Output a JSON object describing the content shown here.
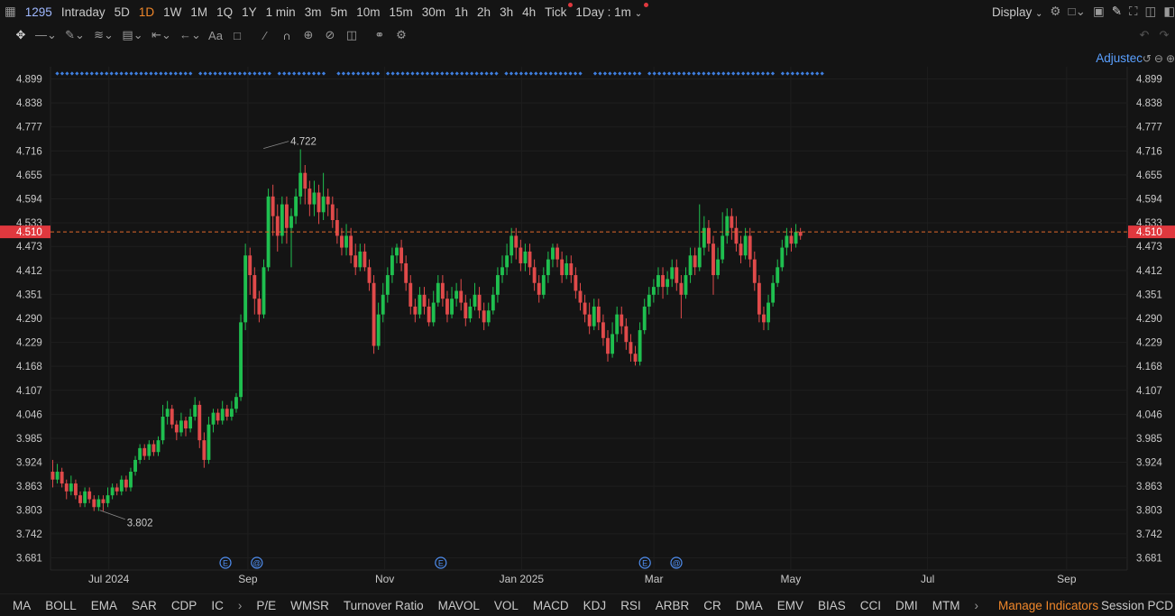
{
  "topbar": {
    "symbol": "1295",
    "timeframes": [
      "Intraday",
      "5D",
      "1D",
      "1W",
      "1M",
      "1Q",
      "1Y",
      "1 min",
      "3m",
      "5m",
      "10m",
      "15m",
      "30m",
      "1h",
      "2h",
      "3h",
      "4h",
      "Tick"
    ],
    "active_timeframe": "1D",
    "interval": "1Day : 1m",
    "display_label": "Display"
  },
  "adjust_label": "Adjustec",
  "chart_data": {
    "type": "candlestick",
    "y_ticks": [
      "4.899",
      "4.838",
      "4.777",
      "4.716",
      "4.655",
      "4.594",
      "4.533",
      "4.473",
      "4.412",
      "4.351",
      "4.290",
      "4.229",
      "4.168",
      "4.107",
      "4.046",
      "3.985",
      "3.924",
      "3.863",
      "3.803",
      "3.742",
      "3.681"
    ],
    "ylim": [
      3.65,
      4.93
    ],
    "x_ticks": [
      {
        "label": "Jul 2024",
        "day": 26
      },
      {
        "label": "Sep",
        "day": 88
      },
      {
        "label": "Nov",
        "day": 149
      },
      {
        "label": "Jan 2025",
        "day": 210
      },
      {
        "label": "Mar",
        "day": 269
      },
      {
        "label": "May",
        "day": 330
      },
      {
        "label": "Jul",
        "day": 391
      },
      {
        "label": "Sep",
        "day": 453
      }
    ],
    "xlim": [
      0,
      480
    ],
    "current_price": "4.510",
    "current_value": 4.51,
    "high_annotation": {
      "label": "4.722",
      "value": 4.722,
      "day": 94
    },
    "low_annotation": {
      "label": "3.802",
      "value": 3.802,
      "day": 11
    },
    "event_markers": [
      {
        "symbol": "E",
        "day": 78
      },
      {
        "symbol": "@",
        "day": 92
      },
      {
        "symbol": "E",
        "day": 174
      },
      {
        "symbol": "E",
        "day": 265
      },
      {
        "symbol": "@",
        "day": 279
      }
    ],
    "candles": [
      [
        3.9,
        3.88,
        3.93,
        3.86
      ],
      [
        3.88,
        3.9,
        3.92,
        3.87
      ],
      [
        3.9,
        3.87,
        3.91,
        3.86
      ],
      [
        3.87,
        3.85,
        3.88,
        3.83
      ],
      [
        3.85,
        3.87,
        3.89,
        3.84
      ],
      [
        3.87,
        3.84,
        3.88,
        3.83
      ],
      [
        3.84,
        3.82,
        3.85,
        3.81
      ],
      [
        3.82,
        3.85,
        3.86,
        3.81
      ],
      [
        3.85,
        3.83,
        3.86,
        3.82
      ],
      [
        3.83,
        3.81,
        3.84,
        3.8
      ],
      [
        3.81,
        3.83,
        3.84,
        3.8
      ],
      [
        3.83,
        3.82,
        3.84,
        3.8
      ],
      [
        3.82,
        3.84,
        3.86,
        3.81
      ],
      [
        3.84,
        3.86,
        3.87,
        3.83
      ],
      [
        3.86,
        3.85,
        3.87,
        3.84
      ],
      [
        3.85,
        3.88,
        3.89,
        3.84
      ],
      [
        3.88,
        3.86,
        3.89,
        3.85
      ],
      [
        3.86,
        3.9,
        3.91,
        3.85
      ],
      [
        3.9,
        3.93,
        3.94,
        3.89
      ],
      [
        3.93,
        3.96,
        3.97,
        3.92
      ],
      [
        3.96,
        3.94,
        3.97,
        3.93
      ],
      [
        3.94,
        3.97,
        3.98,
        3.93
      ],
      [
        3.97,
        3.95,
        3.98,
        3.94
      ],
      [
        3.95,
        3.98,
        3.99,
        3.94
      ],
      [
        3.98,
        4.04,
        4.07,
        3.97
      ],
      [
        4.04,
        4.06,
        4.08,
        4.02
      ],
      [
        4.06,
        4.02,
        4.07,
        4.01
      ],
      [
        4.02,
        4.0,
        4.03,
        3.98
      ],
      [
        4.0,
        4.03,
        4.05,
        3.99
      ],
      [
        4.03,
        4.01,
        4.04,
        3.99
      ],
      [
        4.01,
        4.04,
        4.06,
        4.0
      ],
      [
        4.04,
        4.07,
        4.09,
        4.03
      ],
      [
        4.07,
        3.98,
        4.08,
        3.96
      ],
      [
        3.98,
        3.93,
        4.0,
        3.91
      ],
      [
        3.93,
        4.02,
        4.04,
        3.92
      ],
      [
        4.02,
        4.05,
        4.06,
        4.0
      ],
      [
        4.05,
        4.03,
        4.06,
        4.02
      ],
      [
        4.03,
        4.06,
        4.08,
        4.02
      ],
      [
        4.06,
        4.04,
        4.07,
        4.03
      ],
      [
        4.04,
        4.06,
        4.08,
        4.03
      ],
      [
        4.06,
        4.09,
        4.1,
        4.05
      ],
      [
        4.09,
        4.28,
        4.3,
        4.08
      ],
      [
        4.28,
        4.45,
        4.48,
        4.26
      ],
      [
        4.45,
        4.4,
        4.47,
        4.35
      ],
      [
        4.4,
        4.34,
        4.42,
        4.3
      ],
      [
        4.34,
        4.3,
        4.36,
        4.28
      ],
      [
        4.3,
        4.42,
        4.44,
        4.29
      ],
      [
        4.42,
        4.6,
        4.62,
        4.41
      ],
      [
        4.6,
        4.55,
        4.63,
        4.5
      ],
      [
        4.55,
        4.5,
        4.58,
        4.46
      ],
      [
        4.5,
        4.58,
        4.6,
        4.48
      ],
      [
        4.58,
        4.52,
        4.6,
        4.48
      ],
      [
        4.52,
        4.55,
        4.57,
        4.42
      ],
      [
        4.55,
        4.6,
        4.62,
        4.53
      ],
      [
        4.6,
        4.66,
        4.72,
        4.58
      ],
      [
        4.66,
        4.62,
        4.68,
        4.58
      ],
      [
        4.62,
        4.58,
        4.64,
        4.55
      ],
      [
        4.58,
        4.61,
        4.64,
        4.55
      ],
      [
        4.61,
        4.56,
        4.63,
        4.53
      ],
      [
        4.56,
        4.6,
        4.66,
        4.54
      ],
      [
        4.6,
        4.58,
        4.62,
        4.55
      ],
      [
        4.58,
        4.54,
        4.6,
        4.52
      ],
      [
        4.54,
        4.5,
        4.57,
        4.48
      ],
      [
        4.5,
        4.47,
        4.52,
        4.45
      ],
      [
        4.47,
        4.5,
        4.53,
        4.45
      ],
      [
        4.5,
        4.45,
        4.52,
        4.43
      ],
      [
        4.45,
        4.42,
        4.48,
        4.4
      ],
      [
        4.42,
        4.46,
        4.48,
        4.41
      ],
      [
        4.46,
        4.42,
        4.48,
        4.41
      ],
      [
        4.42,
        4.38,
        4.44,
        4.36
      ],
      [
        4.38,
        4.22,
        4.4,
        4.2
      ],
      [
        4.22,
        4.3,
        4.33,
        4.21
      ],
      [
        4.3,
        4.35,
        4.38,
        4.28
      ],
      [
        4.35,
        4.4,
        4.42,
        4.33
      ],
      [
        4.4,
        4.45,
        4.47,
        4.38
      ],
      [
        4.45,
        4.47,
        4.48,
        4.43
      ],
      [
        4.47,
        4.43,
        4.49,
        4.41
      ],
      [
        4.43,
        4.38,
        4.45,
        4.36
      ],
      [
        4.38,
        4.32,
        4.4,
        4.3
      ],
      [
        4.32,
        4.3,
        4.34,
        4.28
      ],
      [
        4.3,
        4.35,
        4.37,
        4.29
      ],
      [
        4.35,
        4.32,
        4.37,
        4.3
      ],
      [
        4.32,
        4.28,
        4.34,
        4.27
      ],
      [
        4.28,
        4.33,
        4.36,
        4.27
      ],
      [
        4.33,
        4.38,
        4.4,
        4.32
      ],
      [
        4.38,
        4.34,
        4.4,
        4.32
      ],
      [
        4.34,
        4.3,
        4.36,
        4.28
      ],
      [
        4.3,
        4.34,
        4.37,
        4.29
      ],
      [
        4.34,
        4.36,
        4.38,
        4.32
      ],
      [
        4.36,
        4.33,
        4.39,
        4.31
      ],
      [
        4.33,
        4.29,
        4.35,
        4.27
      ],
      [
        4.29,
        4.32,
        4.34,
        4.28
      ],
      [
        4.32,
        4.35,
        4.38,
        4.31
      ],
      [
        4.35,
        4.31,
        4.37,
        4.29
      ],
      [
        4.31,
        4.28,
        4.33,
        4.26
      ],
      [
        4.28,
        4.31,
        4.33,
        4.27
      ],
      [
        4.31,
        4.35,
        4.37,
        4.3
      ],
      [
        4.35,
        4.4,
        4.42,
        4.33
      ],
      [
        4.4,
        4.42,
        4.45,
        4.38
      ],
      [
        4.42,
        4.45,
        4.48,
        4.4
      ],
      [
        4.45,
        4.5,
        4.52,
        4.43
      ],
      [
        4.5,
        4.47,
        4.52,
        4.44
      ],
      [
        4.47,
        4.43,
        4.49,
        4.41
      ],
      [
        4.43,
        4.46,
        4.48,
        4.41
      ],
      [
        4.46,
        4.42,
        4.48,
        4.4
      ],
      [
        4.42,
        4.38,
        4.44,
        4.36
      ],
      [
        4.38,
        4.35,
        4.4,
        4.33
      ],
      [
        4.35,
        4.4,
        4.42,
        4.34
      ],
      [
        4.4,
        4.44,
        4.46,
        4.38
      ],
      [
        4.44,
        4.47,
        4.48,
        4.42
      ],
      [
        4.47,
        4.44,
        4.48,
        4.42
      ],
      [
        4.44,
        4.4,
        4.46,
        4.38
      ],
      [
        4.4,
        4.43,
        4.45,
        4.39
      ],
      [
        4.43,
        4.4,
        4.45,
        4.38
      ],
      [
        4.4,
        4.36,
        4.42,
        4.34
      ],
      [
        4.36,
        4.33,
        4.38,
        4.31
      ],
      [
        4.33,
        4.3,
        4.35,
        4.28
      ],
      [
        4.3,
        4.27,
        4.33,
        4.25
      ],
      [
        4.27,
        4.32,
        4.34,
        4.26
      ],
      [
        4.32,
        4.28,
        4.34,
        4.26
      ],
      [
        4.28,
        4.24,
        4.3,
        4.22
      ],
      [
        4.24,
        4.2,
        4.26,
        4.18
      ],
      [
        4.2,
        4.25,
        4.28,
        4.19
      ],
      [
        4.25,
        4.3,
        4.32,
        4.23
      ],
      [
        4.3,
        4.27,
        4.32,
        4.25
      ],
      [
        4.27,
        4.23,
        4.29,
        4.21
      ],
      [
        4.23,
        4.2,
        4.25,
        4.18
      ],
      [
        4.2,
        4.18,
        4.22,
        4.17
      ],
      [
        4.18,
        4.26,
        4.28,
        4.17
      ],
      [
        4.26,
        4.32,
        4.34,
        4.25
      ],
      [
        4.32,
        4.35,
        4.37,
        4.3
      ],
      [
        4.35,
        4.37,
        4.39,
        4.33
      ],
      [
        4.37,
        4.4,
        4.42,
        4.35
      ],
      [
        4.4,
        4.37,
        4.42,
        4.34
      ],
      [
        4.37,
        4.39,
        4.41,
        4.35
      ],
      [
        4.39,
        4.42,
        4.44,
        4.37
      ],
      [
        4.42,
        4.38,
        4.44,
        4.36
      ],
      [
        4.38,
        4.35,
        4.4,
        4.29
      ],
      [
        4.35,
        4.4,
        4.42,
        4.34
      ],
      [
        4.4,
        4.45,
        4.47,
        4.38
      ],
      [
        4.45,
        4.42,
        4.47,
        4.4
      ],
      [
        4.42,
        4.47,
        4.58,
        4.41
      ],
      [
        4.47,
        4.52,
        4.55,
        4.45
      ],
      [
        4.52,
        4.48,
        4.54,
        4.46
      ],
      [
        4.48,
        4.4,
        4.5,
        4.35
      ],
      [
        4.4,
        4.44,
        4.47,
        4.39
      ],
      [
        4.44,
        4.5,
        4.56,
        4.43
      ],
      [
        4.5,
        4.55,
        4.57,
        4.48
      ],
      [
        4.55,
        4.52,
        4.57,
        4.49
      ],
      [
        4.52,
        4.48,
        4.55,
        4.46
      ],
      [
        4.48,
        4.45,
        4.5,
        4.43
      ],
      [
        4.45,
        4.5,
        4.52,
        4.44
      ],
      [
        4.5,
        4.44,
        4.52,
        4.42
      ],
      [
        4.44,
        4.38,
        4.46,
        4.36
      ],
      [
        4.38,
        4.3,
        4.4,
        4.28
      ],
      [
        4.3,
        4.28,
        4.32,
        4.26
      ],
      [
        4.28,
        4.33,
        4.35,
        4.26
      ],
      [
        4.33,
        4.38,
        4.4,
        4.32
      ],
      [
        4.38,
        4.42,
        4.44,
        4.37
      ],
      [
        4.42,
        4.47,
        4.49,
        4.41
      ],
      [
        4.47,
        4.5,
        4.52,
        4.45
      ],
      [
        4.5,
        4.48,
        4.52,
        4.46
      ],
      [
        4.48,
        4.51,
        4.53,
        4.47
      ],
      [
        4.51,
        4.5,
        4.52,
        4.49
      ]
    ]
  },
  "toolbar_icons": [
    "crosshair-icon",
    "line-icon",
    "pen-icon",
    "pattern-icon",
    "fib-icon",
    "measure-icon",
    "arrow-icon",
    "text-icon",
    "comment-icon",
    "ruler-icon",
    "magnet-icon",
    "lock-icon",
    "hide-icon",
    "trash-icon",
    "compare-icon",
    "settings-icon"
  ],
  "bottombar": {
    "indicators": [
      "MA",
      "BOLL",
      "EMA",
      "SAR",
      "CDP",
      "IC",
      "P/E",
      "WMSR",
      "Turnover Ratio",
      "MAVOL",
      "VOL",
      "MACD",
      "KDJ",
      "RSI",
      "ARBR",
      "CR",
      "DMA",
      "EMV",
      "BIAS",
      "CCI",
      "DMI",
      "MTM"
    ],
    "manage_label": "Manage Indicators",
    "session_label": "Session",
    "pcd_label": "PCD"
  }
}
